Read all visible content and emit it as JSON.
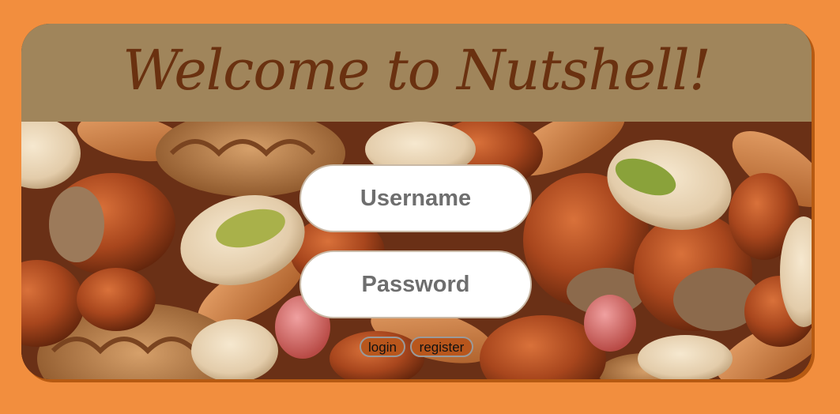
{
  "header": {
    "title": "Welcome to Nutshell!"
  },
  "form": {
    "username_placeholder": "Username",
    "password_placeholder": "Password",
    "login_label": "login",
    "register_label": "register"
  },
  "background": {
    "image": "mixed-nuts-photo"
  },
  "colors": {
    "page_background": "#f28e3e",
    "header_background": "#a0855b",
    "title_text": "#6a3110",
    "button_background": "#b8561c"
  }
}
